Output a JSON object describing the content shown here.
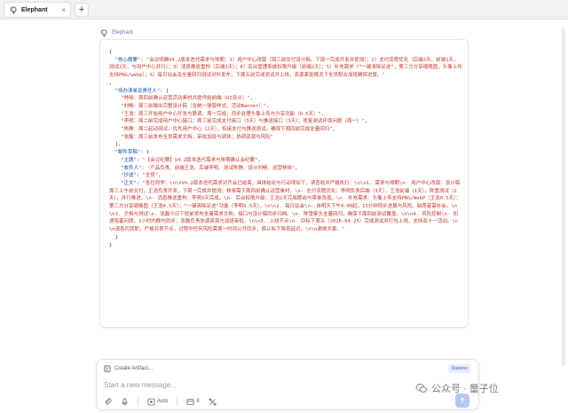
{
  "tab": {
    "title": "Elephant",
    "close": "×"
  },
  "new_tab": "+",
  "sender": {
    "name": "Elephant"
  },
  "code_lines": [
    [
      {
        "t": "p",
        "v": "{"
      }
    ],
    [
      {
        "t": "p",
        "v": "  "
      },
      {
        "t": "k",
        "v": "\"核心摘要\""
      },
      {
        "t": "p",
        "v": ": "
      },
      {
        "t": "s",
        "v": "\"会议明确V4.2版本迭代需求与排期：1）用户中心改版（周三前交付设计稿，下周一完成开发并提测）；2）支付流程优化（后端3天、前端1天，测试2天，与用户中心并行）；3）消息推送重构（后端3天）；4）后台管理系统权限升级（前端2天）；5）补充需求（“一键清除足迹”，第三方分享缩略图，头像上传支持PNG/webp）；6）每日站会及全量回归测试对外发布；下周五前完成测试并上线，资源紧张情况下全员配合加班确保进度。\""
      }
    ],
    [
      {
        "t": "p",
        "v": ","
      }
    ],
    [
      {
        "t": "p",
        "v": "  "
      },
      {
        "t": "k",
        "v": "\"待办清单及责任人\""
      },
      {
        "t": "p",
        "v": ": ["
      }
    ],
    [
      {
        "t": "p",
        "v": "    "
      },
      {
        "t": "s",
        "v": "\"林晓：周四前确认运营活动素材并提供给前端（UI设计）\""
      },
      {
        "t": "p",
        "v": ","
      }
    ],
    [
      {
        "t": "p",
        "v": "    "
      },
      {
        "t": "s",
        "v": "\"刘畅：周三前输出完整设计稿（含统一弹窗样式、活动Banner）\""
      },
      {
        "t": "p",
        "v": ","
      }
    ],
    [
      {
        "t": "p",
        "v": "    "
      },
      {
        "t": "s",
        "v": "\"王浩：周三开始用户中心开发与联调，周一完成；同步处理头像上传与分享功能（0.5天）\""
      },
      {
        "t": "p",
        "v": ","
      }
    ],
    [
      {
        "t": "p",
        "v": "    "
      },
      {
        "t": "s",
        "v": "\"李明：周二前完成用户中心接口；周三前完成支付接口（3天）与推送接口（3天）；修复测试环境问题（周一）\""
      },
      {
        "t": "p",
        "v": ","
      }
    ],
    [
      {
        "t": "p",
        "v": "    "
      },
      {
        "t": "s",
        "v": "\"陈静：周二起动测试，优先用户中心（2天），衔接支付与推送测试，确保下周四前完成全量回归\""
      },
      {
        "t": "p",
        "v": ","
      }
    ],
    [
      {
        "t": "p",
        "v": "    "
      },
      {
        "t": "s",
        "v": "\"张磊：周三前发布全员需求文档，审批加班与调休；协调资源与风险\""
      }
    ],
    [
      {
        "t": "p",
        "v": "  ],"
      }
    ],
    [
      {
        "t": "p",
        "v": "  "
      },
      {
        "t": "k",
        "v": "\"邮件草稿\""
      },
      {
        "t": "p",
        "v": ": {"
      }
    ],
    [
      {
        "t": "p",
        "v": "    "
      },
      {
        "t": "k",
        "v": "\"主题\""
      },
      {
        "t": "p",
        "v": ": "
      },
      {
        "t": "s",
        "v": "\"【会议纪要】V4.2版本迭代需求与排期确认会纪要\""
      },
      {
        "t": "p",
        "v": ","
      }
    ],
    [
      {
        "t": "p",
        "v": "    "
      },
      {
        "t": "k",
        "v": "\"收件人\""
      },
      {
        "t": "p",
        "v": ": "
      },
      {
        "t": "s",
        "v": "\"产品负责、前端王浩、后端李明、测试陈静、设计刘畅、运营林晓\""
      },
      {
        "t": "p",
        "v": ","
      }
    ],
    [
      {
        "t": "p",
        "v": "    "
      },
      {
        "t": "k",
        "v": "\"抄送\""
      },
      {
        "t": "p",
        "v": ": "
      },
      {
        "t": "s",
        "v": "\"全员\""
      },
      {
        "t": "p",
        "v": ","
      }
    ],
    [
      {
        "t": "p",
        "v": "    "
      },
      {
        "t": "k",
        "v": "\"正文\""
      },
      {
        "t": "p",
        "v": ": "
      },
      {
        "t": "s",
        "v": "\"各位同学：\\n\\nV4.2版本迭代需求对齐会已结束，具体结论与行动项如下，请查收并严格执行：\\n\\n1. 需求与排期\\n- 用户中心改版：设计稿周三上午前交付，王浩负责开发，下周一完成并提测；林晓需于周四前确认运营素材。\\n- 支付流程优化：李明负责后端（3天），王浩前端（1天），陈雪测试（2天），并行推进。\\n- 消息推送重构：李明3天完成。\\n- 后台权限升级：王浩2天完成题由与菜单改造。\\n- 补充需求：头像上传支持PNG/WebP（王浩0.5天）；第三方分享缩略图（王浩0.5天）；“一键清除足迹”功能（李明0.5天）。\\n\\n2. 每日站会\\n- 自明天下午4:00起，15分钟同步进展与风险，缺席者需补会。\\n\\n3. 文档与测试\\n- 张磊今日下班前发布全量需求文档，接口与设计稿同步归档。\\n- 陈雪牵头全量回归，确保下周四前测试覆盖。\\n\\n4. 风险控制\\n- 如遇阻塞问题，1小时内群内同步；张磊负责协调资源与加班审批。\\n\\n5. 上线节点\\n- 目标下周五（2026-04-25）完成测试并打包上线，支持双十一活动。\\n\\n请各司其职，严格对表节点，过程中任何风险需第一时间公开同步，禁止私下降低延迟。\\n\\n谢谢大家。\""
      }
    ],
    [
      {
        "t": "p",
        "v": "  }"
      }
    ],
    [
      {
        "t": "p",
        "v": "}"
      }
    ]
  ],
  "composer": {
    "create_artifact": "Create Artifact...",
    "badge": "Dateline",
    "placeholder": "Start a new message...",
    "model_label": "Auto",
    "count": "8"
  },
  "watermark": {
    "text": "公众号 · 量子位"
  },
  "colors": {
    "key": "#0f4ea6",
    "string": "#c0392b",
    "accent": "#b9c6f4",
    "badge_bg": "#e8eefc"
  },
  "icons": [
    "elephant-logo-icon",
    "close-icon",
    "plus-icon",
    "artifact-icon",
    "attach-icon",
    "mic-icon",
    "model-icon",
    "tools-icon",
    "settings-icon",
    "send-icon",
    "wechat-icon"
  ]
}
